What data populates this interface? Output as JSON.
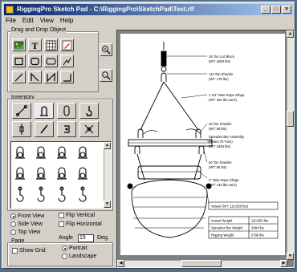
{
  "window": {
    "title": "RiggingPro Sketch Pad - C:\\RiggingPro\\SketchPad\\Test.rlf",
    "controls": {
      "minimize": "_",
      "maximize": "□",
      "close": "×"
    }
  },
  "menu": [
    "File",
    "Edit",
    "View",
    "Help"
  ],
  "left_panel": {
    "drag_drop_label": "Drag and Drop Object",
    "inventory_label": "Inventory",
    "views": [
      {
        "label": "Front View",
        "selected": true
      },
      {
        "label": "Side View",
        "selected": false
      },
      {
        "label": "Top View",
        "selected": false
      }
    ],
    "flip": [
      {
        "label": "Flip Vertical",
        "checked": false
      },
      {
        "label": "Flip Horizontal",
        "checked": false
      }
    ],
    "angle_label": "Angle",
    "angle_value": "15",
    "angle_unit": "Deg.",
    "page_label": "Page",
    "show_grid_label": "Show Grid",
    "orientation": [
      {
        "label": "Portrait",
        "selected": true
      },
      {
        "label": "Landscape",
        "selected": false
      }
    ]
  },
  "drawing": {
    "callouts": [
      "15 Ton Lcd Block",
      "(WT: 4000 lbs)",
      "110 Ton Shackle",
      "(WT: 178 lbs)",
      "1 1/2\" Wire Rope Slings",
      "(WT: 464 lbs each)",
      "30 Ton Shackle",
      "(WT: 96 lbs)",
      "Spreader Bar Assembly",
      "(Rated 70 Tons)",
      "(WT: 3484 lbs)",
      "60 Ton Shackle",
      "(WT: 96 lbs)",
      "2\" Wire Rope Slings",
      "(WT: 140 lbs each)",
      "Vessel (WT: 110,550 lbs)"
    ],
    "weights_table": [
      {
        "name": "Vessel Weight",
        "value": "110,550 lbs"
      },
      {
        "name": "Spreader Bar Weight",
        "value": "3484 lbs"
      },
      {
        "name": "Rigging Weight",
        "value": "5798 lbs"
      }
    ]
  },
  "colors": {
    "title_start": "#0a246a",
    "title_end": "#a6caf0",
    "face": "#d4d0c8"
  }
}
